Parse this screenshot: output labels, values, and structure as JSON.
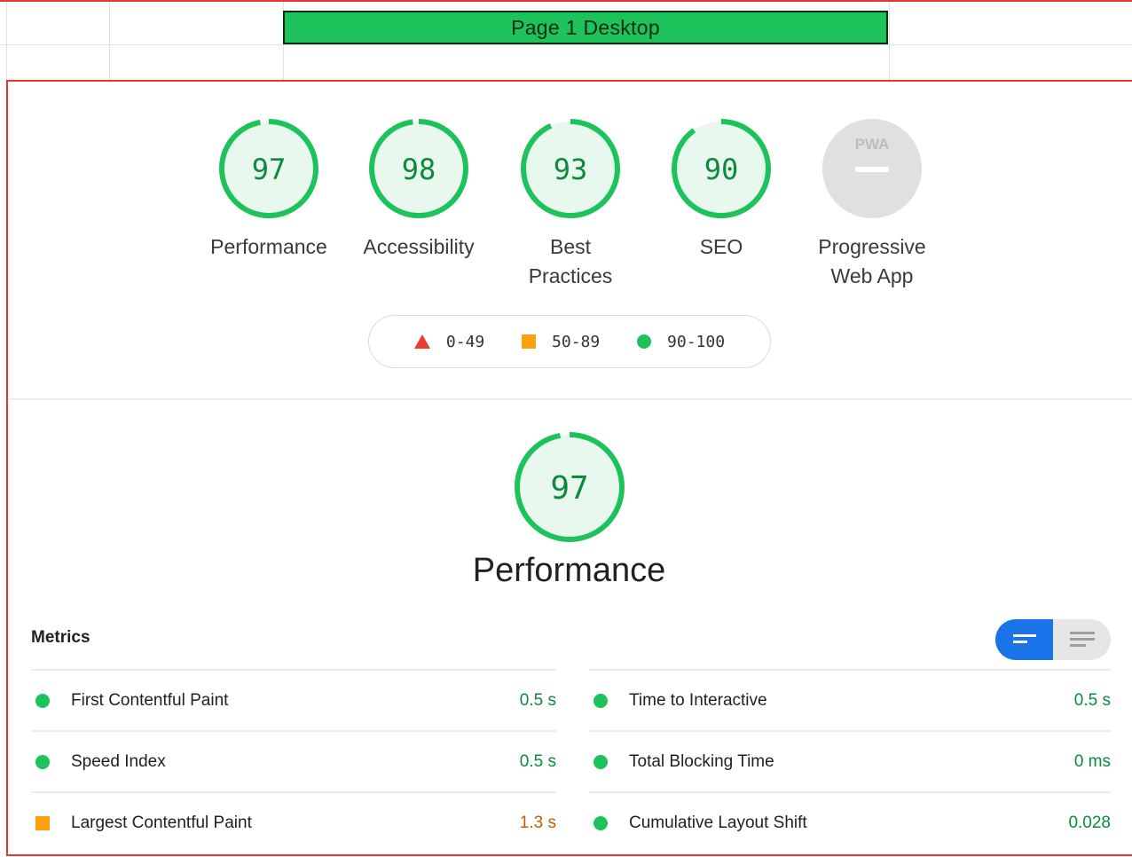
{
  "sheet": {
    "header_title": "Page 1 Desktop"
  },
  "colors": {
    "pass": "#1ec25b",
    "average": "#f9a10f",
    "fail": "#ef3b30",
    "toggle_active": "#1a73e8"
  },
  "categories": [
    {
      "score": "97",
      "label": "Performance"
    },
    {
      "score": "98",
      "label": "Accessibility"
    },
    {
      "score": "93",
      "label": "Best Practices"
    },
    {
      "score": "90",
      "label": "SEO"
    },
    {
      "score": "PWA",
      "label": "Progressive Web App"
    }
  ],
  "legend": [
    {
      "icon": "triangle-icon",
      "range": "0-49"
    },
    {
      "icon": "square-icon",
      "range": "50-89"
    },
    {
      "icon": "circle-icon",
      "range": "90-100"
    }
  ],
  "performance": {
    "score": "97",
    "title": "Performance"
  },
  "metrics": {
    "title": "Metrics",
    "left": [
      {
        "name": "First Contentful Paint",
        "value": "0.5 s",
        "rating": "pass"
      },
      {
        "name": "Speed Index",
        "value": "0.5 s",
        "rating": "pass"
      },
      {
        "name": "Largest Contentful Paint",
        "value": "1.3 s",
        "rating": "average"
      }
    ],
    "right": [
      {
        "name": "Time to Interactive",
        "value": "0.5 s",
        "rating": "pass"
      },
      {
        "name": "Total Blocking Time",
        "value": "0 ms",
        "rating": "pass"
      },
      {
        "name": "Cumulative Layout Shift",
        "value": "0.028",
        "rating": "pass"
      }
    ]
  }
}
